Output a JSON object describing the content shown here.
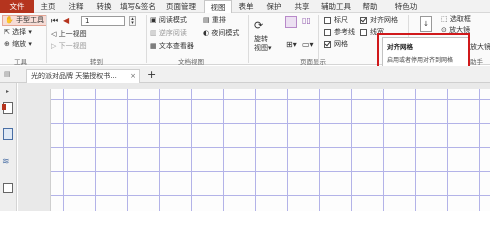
{
  "menubar": {
    "file": "文件",
    "items": [
      "主页",
      "注释",
      "转换",
      "填写&签名",
      "页面管理",
      "视图",
      "表单",
      "保护",
      "共享",
      "辅助工具",
      "帮助",
      "特色功"
    ]
  },
  "ribbon": {
    "tools": {
      "hand": "手型工具",
      "select": "选择",
      "zoom": "缩放",
      "group": "工具"
    },
    "goto": {
      "page_value": "1",
      "prev_view": "上一视图",
      "next_view": "下一视图",
      "group": "转到"
    },
    "docview": {
      "read_mode": "阅读模式",
      "reflow": "重排",
      "reverse_read": "逆序阅读",
      "night_mode": "夜间模式",
      "text_viewer": "文本查看器",
      "group": "文档视图"
    },
    "rotate": {
      "label_1": "旋转",
      "label_2": "视图"
    },
    "pagedisplay": {
      "group": "页面显示"
    },
    "show": {
      "ruler": "标尺",
      "snap_grid": "对齐网格",
      "guides": "参考线",
      "line_width": "线宽",
      "grid": "网格",
      "ruler_checked": false,
      "snap_checked": true,
      "guides_checked": false,
      "linewidth_checked": false,
      "grid_checked": true
    },
    "right": {
      "selection": "选取框",
      "magnifier": "放大镜",
      "zoom_glass": "放大镜",
      "assistant": "助手"
    }
  },
  "tooltip": {
    "title": "对齐网格",
    "desc": "启用或者停用对齐到网格"
  },
  "tabs": {
    "doc": "光的派对品牌 天猫授权书...",
    "close": "×",
    "new": "+"
  }
}
